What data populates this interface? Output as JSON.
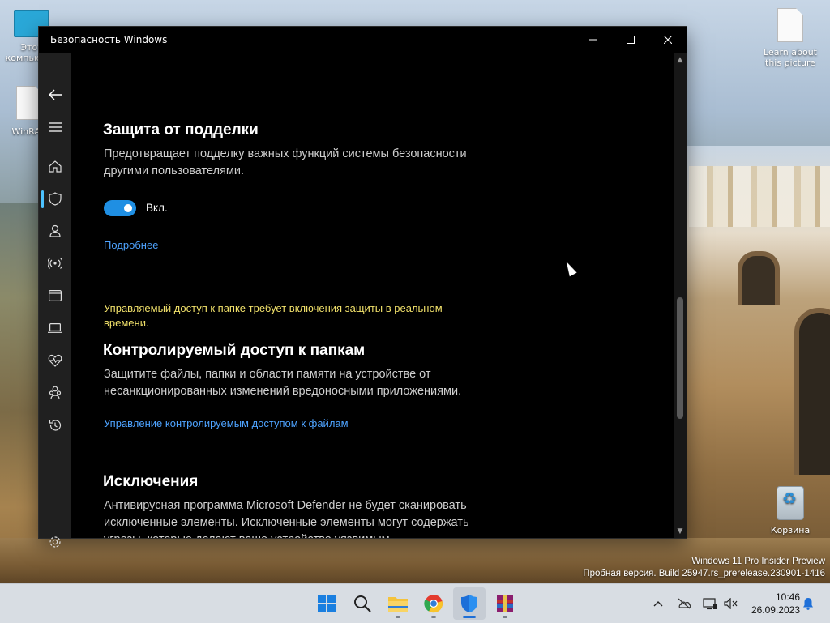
{
  "desktop": {
    "icons": [
      {
        "label": "Этот компьютер"
      },
      {
        "label": "WinRAR"
      },
      {
        "label": "Learn about this picture"
      },
      {
        "label": "Корзина"
      }
    ],
    "watermark_line1": "Windows 11 Pro Insider Preview",
    "watermark_line2": "Пробная версия. Build 25947.rs_prerelease.230901-1416"
  },
  "window": {
    "title": "Безопасность Windows",
    "controls": {
      "minimize": "—",
      "maximize": "☐",
      "close": "✕"
    }
  },
  "nav": {
    "items": [
      {
        "name": "back",
        "icon": "back-arrow-icon"
      },
      {
        "name": "menu",
        "icon": "hamburger-icon"
      },
      {
        "name": "home",
        "icon": "home-icon"
      },
      {
        "name": "virus-protection",
        "icon": "shield-icon",
        "active": true
      },
      {
        "name": "account-protection",
        "icon": "person-icon"
      },
      {
        "name": "firewall",
        "icon": "wireless-icon"
      },
      {
        "name": "app-browser-control",
        "icon": "window-icon"
      },
      {
        "name": "device-security",
        "icon": "laptop-icon"
      },
      {
        "name": "device-performance",
        "icon": "heart-pulse-icon"
      },
      {
        "name": "family-options",
        "icon": "family-icon"
      },
      {
        "name": "protection-history",
        "icon": "history-icon"
      },
      {
        "name": "settings",
        "icon": "gear-icon"
      }
    ],
    "accent": "#4cc2ff"
  },
  "sections": {
    "tamper": {
      "title": "Защита от подделки",
      "desc": "Предотвращает подделку важных функций системы безопасности другими пользователями.",
      "toggle_state": "Вкл.",
      "link": "Подробнее"
    },
    "warning": "Управляемый доступ к папке требует включения защиты в реальном времени.",
    "cfa": {
      "title": "Контролируемый доступ к папкам",
      "desc": "Защитите файлы, папки и области памяти на устройстве от несанкционированных изменений вредоносными приложениями.",
      "link": "Управление контролируемым доступом к файлам"
    },
    "exclusions": {
      "title": "Исключения",
      "desc": "Антивирусная программа Microsoft Defender не будет сканировать исключенные элементы. Исключенные элементы могут содержать угрозы, которые делают ваше устройство уязвимым."
    }
  },
  "colors": {
    "link": "#4ea3ff",
    "warning": "#f0e06a",
    "toggle_on": "#1f8fe3"
  },
  "taskbar": {
    "apps": [
      "windows-start-icon",
      "search-icon",
      "file-explorer-icon",
      "chrome-icon",
      "windows-security-icon",
      "winrar-icon"
    ],
    "active_app": "windows-security-icon",
    "tray": [
      "chevron-up-icon",
      "onedrive-icon",
      "network-icon",
      "volume-muted-icon"
    ],
    "time": "10:46",
    "date": "26.09.2023"
  }
}
